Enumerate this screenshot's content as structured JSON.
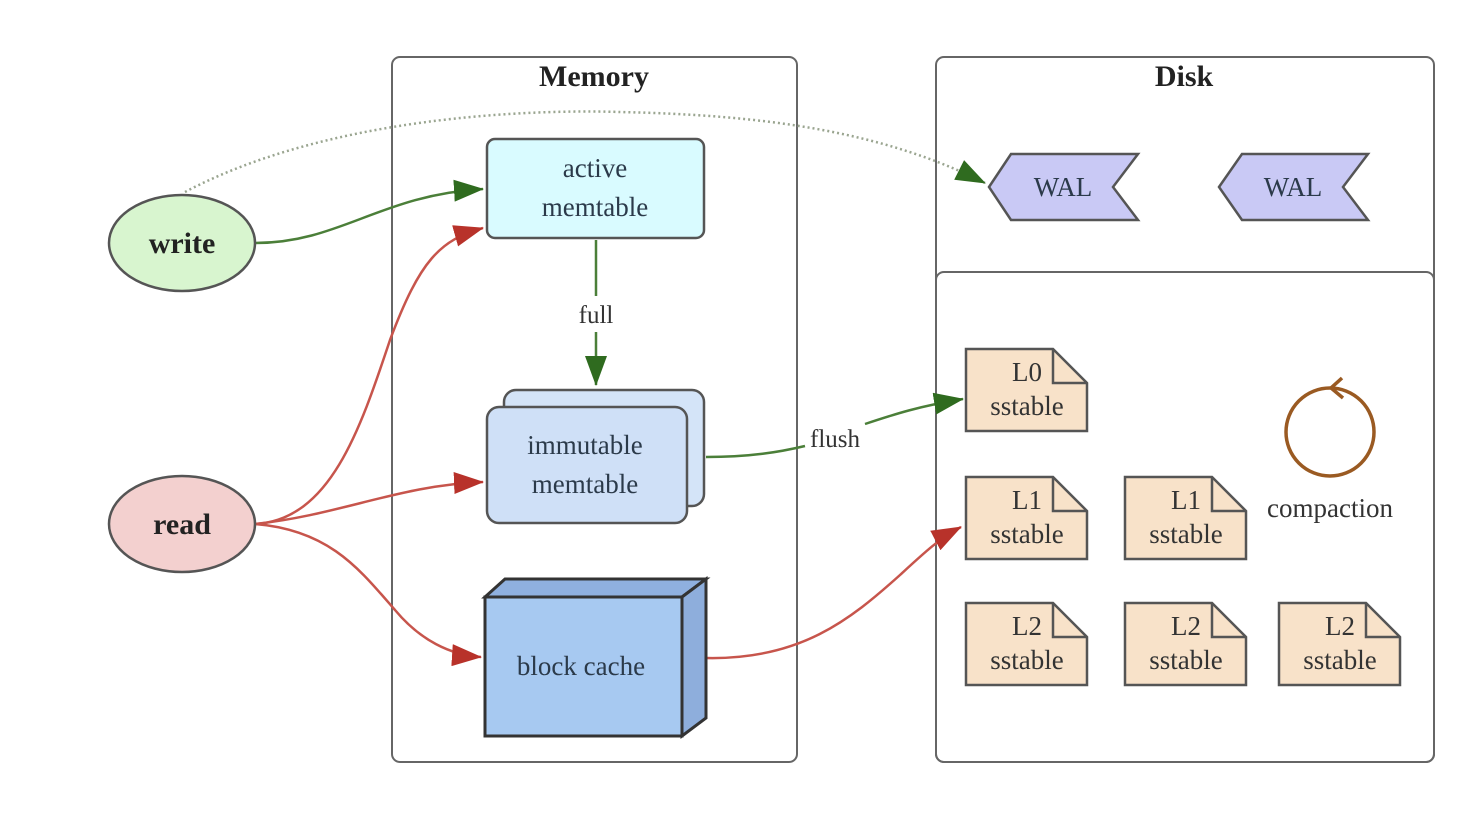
{
  "diagram": {
    "groups": {
      "memory": {
        "title": "Memory"
      },
      "disk": {
        "title": "Disk"
      }
    },
    "actors": {
      "write": {
        "label": "write",
        "fill": "#d8f5cf"
      },
      "read": {
        "label": "read",
        "fill": "#f3d0cf"
      }
    },
    "memory_nodes": {
      "active_memtable": {
        "line1": "active",
        "line2": "memtable",
        "fill": "#d9fbff"
      },
      "immutable_memtable": {
        "line1": "immutable",
        "line2": "memtable",
        "fill": "#cfe0f7"
      },
      "block_cache": {
        "label": "block cache",
        "fill": "#a7c9f1"
      }
    },
    "wal": [
      {
        "label": "WAL"
      },
      {
        "label": "WAL"
      }
    ],
    "sstables": [
      {
        "level": "L0",
        "label": "sstable"
      },
      {
        "level": "L1",
        "label": "sstable"
      },
      {
        "level": "L1",
        "label": "sstable"
      },
      {
        "level": "L2",
        "label": "sstable"
      },
      {
        "level": "L2",
        "label": "sstable"
      },
      {
        "level": "L2",
        "label": "sstable"
      }
    ],
    "compaction": {
      "label": "compaction",
      "color": "#9a5a22"
    },
    "edge_labels": {
      "full": "full",
      "flush": "flush"
    },
    "colors": {
      "write_edge": "#3e7a2c",
      "read_edge": "#c0483e",
      "sstable_fill": "#f8e2c9",
      "wal_fill": "#c9c9f5"
    }
  }
}
